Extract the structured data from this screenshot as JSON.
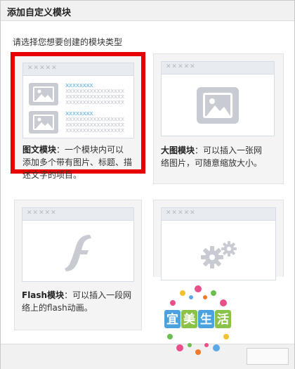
{
  "dialog": {
    "title": "添加自定义模块",
    "close_glyph": "×",
    "prompt": "请选择您想要创建的模块类型"
  },
  "cards": [
    {
      "id": "image-text",
      "preview_stars": "✕✕✕✕✕",
      "name": "图文模块",
      "desc_line1": "：一个模块内可以",
      "desc_line2": "添加多个带有图片、标题、描",
      "desc_line3": "述文字的项目。",
      "selected": true
    },
    {
      "id": "large-image",
      "preview_stars": "✕✕✕✕✕",
      "name": "大图模块",
      "desc_line1": "：可以插入一张网",
      "desc_line2": "络图片，可随意缩放大小。"
    },
    {
      "id": "flash",
      "preview_stars": "✕✕✕✕✕",
      "name": "Flash模块",
      "desc_line1": "：可以插入一段网",
      "desc_line2": "络上的flash动画。"
    },
    {
      "id": "app",
      "preview_stars": "✕✕✕✕✕"
    }
  ],
  "preview_text": {
    "accent": "xxxxxxxx",
    "line": "xxxxxxxxxxxxxxxxx"
  },
  "watermark": {
    "chars": [
      "宜",
      "美",
      "生",
      "活"
    ]
  },
  "colors": {
    "selection": "#e60000",
    "accent_blue": "#61b3e6",
    "icon_gray": "#c8ccd2"
  }
}
